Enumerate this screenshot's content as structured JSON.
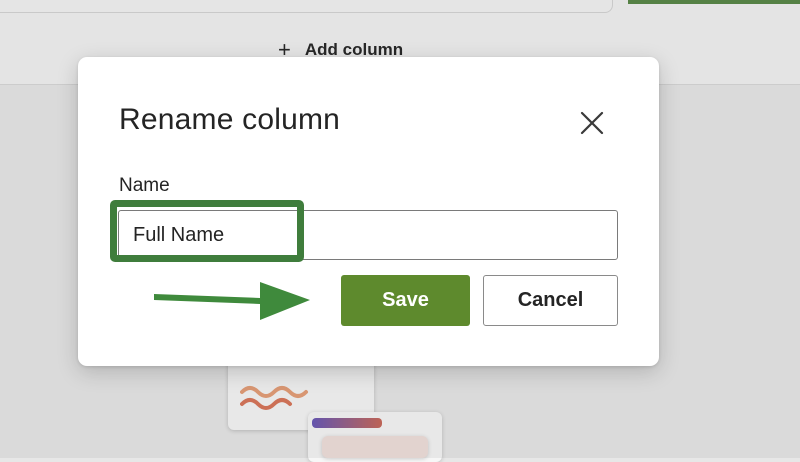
{
  "background": {
    "add_column_icon": "plus-icon",
    "add_column_label": "Add column"
  },
  "dialog": {
    "title": "Rename column",
    "close_icon": "close-icon",
    "name_label": "Name",
    "name_value": "Full Name",
    "save_label": "Save",
    "cancel_label": "Cancel"
  },
  "annotations": {
    "highlight_color": "#3f7d3c",
    "arrow_color": "#3f8a3c",
    "arrow_icon": "arrow-right-icon"
  },
  "colors": {
    "primary_button": "#5e8a2d",
    "text": "#242424"
  }
}
